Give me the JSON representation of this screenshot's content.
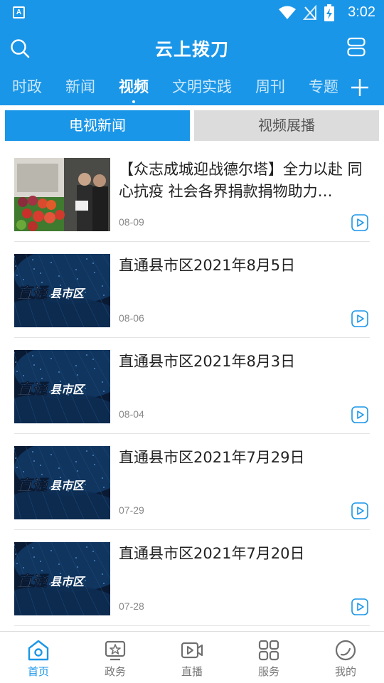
{
  "status_bar": {
    "time": "3:02",
    "app_badge": "A"
  },
  "header": {
    "title": "云上拨刀"
  },
  "channels": [
    {
      "label": "时政",
      "active": false
    },
    {
      "label": "新闻",
      "active": false
    },
    {
      "label": "视频",
      "active": true
    },
    {
      "label": "文明实践",
      "active": false
    },
    {
      "label": "周刊",
      "active": false
    },
    {
      "label": "专题",
      "active": false
    }
  ],
  "subtabs": [
    {
      "label": "电视新闻",
      "active": true
    },
    {
      "label": "视频展播",
      "active": false
    }
  ],
  "thumb_overlay_text": "直通县市区",
  "videos": [
    {
      "title": "【众志成城迎战德尔塔】全力以赴 同心抗疫 社会各界捐款捐物助力…",
      "date": "08-09",
      "thumb": "photo"
    },
    {
      "title": "直通县市区2021年8月5日",
      "date": "08-06",
      "thumb": "logo"
    },
    {
      "title": "直通县市区2021年8月3日",
      "date": "08-04",
      "thumb": "logo"
    },
    {
      "title": "直通县市区2021年7月29日",
      "date": "07-29",
      "thumb": "logo"
    },
    {
      "title": "直通县市区2021年7月20日",
      "date": "07-28",
      "thumb": "logo"
    }
  ],
  "bottom_nav": [
    {
      "label": "首页",
      "icon": "home-icon",
      "active": true
    },
    {
      "label": "政务",
      "icon": "government-icon",
      "active": false
    },
    {
      "label": "直播",
      "icon": "live-icon",
      "active": false
    },
    {
      "label": "服务",
      "icon": "services-grid-icon",
      "active": false
    },
    {
      "label": "我的",
      "icon": "profile-icon",
      "active": false
    }
  ],
  "colors": {
    "primary": "#1a96e8",
    "inactive_tab": "#dcdcdc",
    "text": "#222222",
    "muted": "#888888"
  }
}
